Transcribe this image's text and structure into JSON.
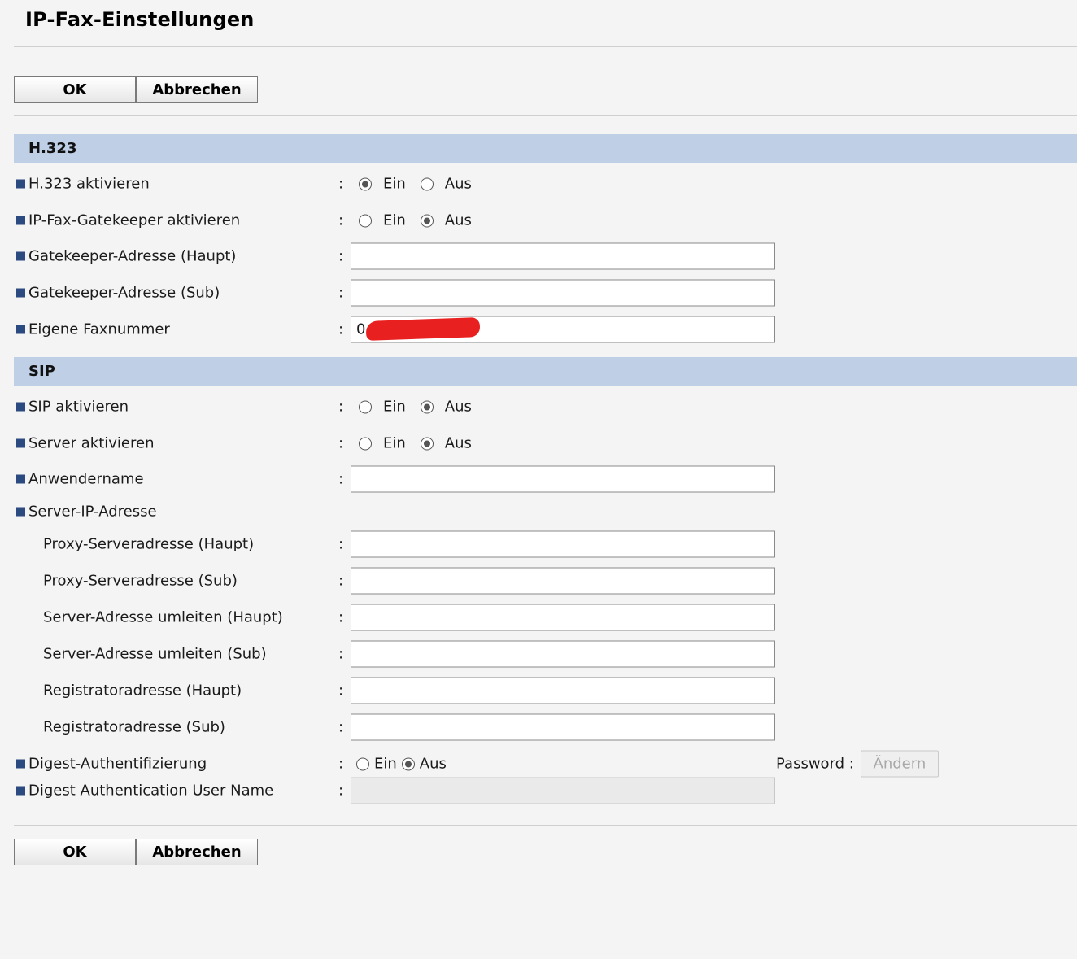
{
  "page": {
    "title": "IP-Fax-Einstellungen"
  },
  "buttons": {
    "ok": "OK",
    "cancel": "Abbrechen"
  },
  "options": {
    "on": "Ein",
    "off": "Aus"
  },
  "h323": {
    "header": "H.323",
    "enable": {
      "label": "H.323 aktivieren",
      "value": "Ein"
    },
    "gatekeeper_enable": {
      "label": "IP-Fax-Gatekeeper aktivieren",
      "value": "Aus"
    },
    "gatekeeper_main": {
      "label": "Gatekeeper-Adresse (Haupt)",
      "value": ""
    },
    "gatekeeper_sub": {
      "label": "Gatekeeper-Adresse (Sub)",
      "value": ""
    },
    "own_fax": {
      "label": "Eigene Faxnummer",
      "value": "0"
    }
  },
  "sip": {
    "header": "SIP",
    "enable": {
      "label": "SIP aktivieren",
      "value": "Aus"
    },
    "server_enable": {
      "label": "Server aktivieren",
      "value": "Aus"
    },
    "username": {
      "label": "Anwendername",
      "value": ""
    },
    "server_ip": {
      "label": "Server-IP-Adresse"
    },
    "proxy_main": {
      "label": "Proxy-Serveradresse (Haupt)",
      "value": ""
    },
    "proxy_sub": {
      "label": "Proxy-Serveradresse (Sub)",
      "value": ""
    },
    "redirect_main": {
      "label": "Server-Adresse umleiten (Haupt)",
      "value": ""
    },
    "redirect_sub": {
      "label": "Server-Adresse umleiten (Sub)",
      "value": ""
    },
    "registrar_main": {
      "label": "Registratoradresse (Haupt)",
      "value": ""
    },
    "registrar_sub": {
      "label": "Registratoradresse (Sub)",
      "value": ""
    },
    "digest": {
      "label": "Digest-Authentifizierung",
      "value": "Aus"
    },
    "password_label": "Password :",
    "change_label": "Ändern",
    "digest_user": {
      "label": "Digest Authentication User Name",
      "value": ""
    }
  },
  "colon": ":"
}
